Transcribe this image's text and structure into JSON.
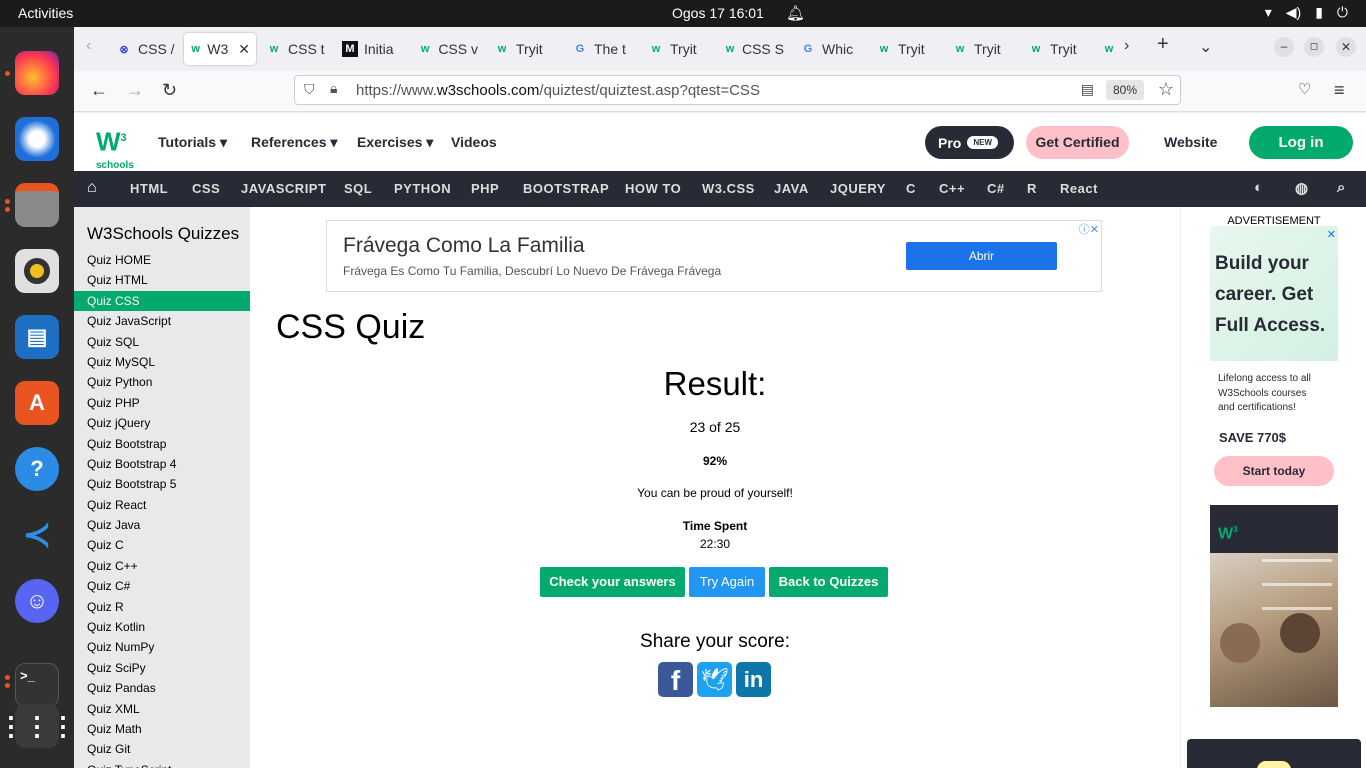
{
  "system": {
    "activities": "Activities",
    "clock": "Ogos 17  16:01"
  },
  "tabs": [
    {
      "label": "CSS /",
      "fav": "⊗"
    },
    {
      "label": "W3",
      "fav": "w"
    },
    {
      "label": "CSS t",
      "fav": "w"
    },
    {
      "label": "Initia",
      "fav": "M"
    },
    {
      "label": "CSS v",
      "fav": "w"
    },
    {
      "label": "Tryit",
      "fav": "w"
    },
    {
      "label": "The t",
      "fav": "G"
    },
    {
      "label": "Tryit",
      "fav": "w"
    },
    {
      "label": "CSS S",
      "fav": "w"
    },
    {
      "label": "Whic",
      "fav": "G"
    },
    {
      "label": "Tryit",
      "fav": "w"
    },
    {
      "label": "Tryit",
      "fav": "w"
    },
    {
      "label": "Tryit",
      "fav": "w"
    }
  ],
  "url": {
    "prefix": "https://www.",
    "domain": "w3schools.com",
    "path": "/quiztest/quiztest.asp?qtest=CSS",
    "zoom": "80%"
  },
  "w3header": {
    "logo_sub": "schools",
    "menu": [
      "Tutorials ▾",
      "References ▾",
      "Exercises ▾",
      "Videos"
    ],
    "pro": "Pro",
    "pro_badge": "NEW",
    "certified": "Get Certified",
    "website": "Website",
    "login": "Log in"
  },
  "topnav": [
    "HTML",
    "CSS",
    "JAVASCRIPT",
    "SQL",
    "PYTHON",
    "PHP",
    "BOOTSTRAP",
    "HOW TO",
    "W3.CSS",
    "JAVA",
    "JQUERY",
    "C",
    "C++",
    "C#",
    "R",
    "React"
  ],
  "sidebar": {
    "title": "W3Schools Quizzes",
    "items": [
      "Quiz HOME",
      "Quiz HTML",
      "Quiz CSS",
      "Quiz JavaScript",
      "Quiz SQL",
      "Quiz MySQL",
      "Quiz Python",
      "Quiz PHP",
      "Quiz jQuery",
      "Quiz Bootstrap",
      "Quiz Bootstrap 4",
      "Quiz Bootstrap 5",
      "Quiz React",
      "Quiz Java",
      "Quiz C",
      "Quiz C++",
      "Quiz C#",
      "Quiz R",
      "Quiz Kotlin",
      "Quiz NumPy",
      "Quiz SciPy",
      "Quiz Pandas",
      "Quiz XML",
      "Quiz Math",
      "Quiz Git",
      "Quiz TypeScript"
    ],
    "active_index": 2
  },
  "ad_top": {
    "title": "Frávega Como La Familia",
    "subtitle": "Frávega Es Como Tu Familia, Descubrí Lo Nuevo De Frávega Frávega",
    "button": "Abrir"
  },
  "quiz": {
    "title": "CSS Quiz",
    "result_heading": "Result:",
    "score": "23 of 25",
    "percent": "92%",
    "message": "You can be proud of yourself!",
    "time_label": "Time Spent",
    "time_value": "22:30",
    "buttons": {
      "check": "Check your answers",
      "retry": "Try Again",
      "back": "Back to Quizzes"
    },
    "share": "Share your score:"
  },
  "ad_right": {
    "label": "ADVERTISEMENT",
    "headline_lines": [
      "Build your",
      "career. Get",
      "Full Access."
    ],
    "body_lines": [
      "Lifelong access to all",
      "W3Schools courses",
      "and certifications!"
    ],
    "save": "SAVE 770$",
    "cta": "Start today"
  }
}
